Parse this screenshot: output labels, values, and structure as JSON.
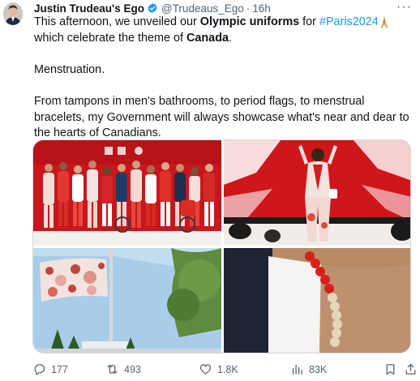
{
  "post": {
    "author_name": "Justin Trudeau's Ego",
    "author_handle": "@Trudeaus_Ego",
    "separator": "·",
    "time": "16h",
    "verified": true,
    "text": {
      "p1_a": "This afternoon, we unveiled our ",
      "p1_bold1": "Olympic uniforms",
      "p1_b": " for ",
      "p1_hashtag": "#Paris2024",
      "p1_c": "which celebrate the theme of ",
      "p1_bold2": "Canada",
      "p1_end": ".",
      "p2": "Menstruation.",
      "p3": "From tampons in men's bathrooms, to period flags, to menstrual bracelets, my Government will always showcase what's near and dear to the hearts of Canadians."
    },
    "media": [
      {
        "icon": "team-canada-uniforms-photo"
      },
      {
        "icon": "runway-model-photo"
      },
      {
        "icon": "period-flag-photo"
      },
      {
        "icon": "red-bead-bracelet-photo"
      }
    ],
    "metrics": {
      "replies": "177",
      "reposts": "493",
      "likes": "1.8K",
      "views": "83K"
    },
    "colors": {
      "accent": "#1d9bf0",
      "text": "#0f1419",
      "muted": "#536471",
      "canada_red": "#d52b1e"
    }
  }
}
